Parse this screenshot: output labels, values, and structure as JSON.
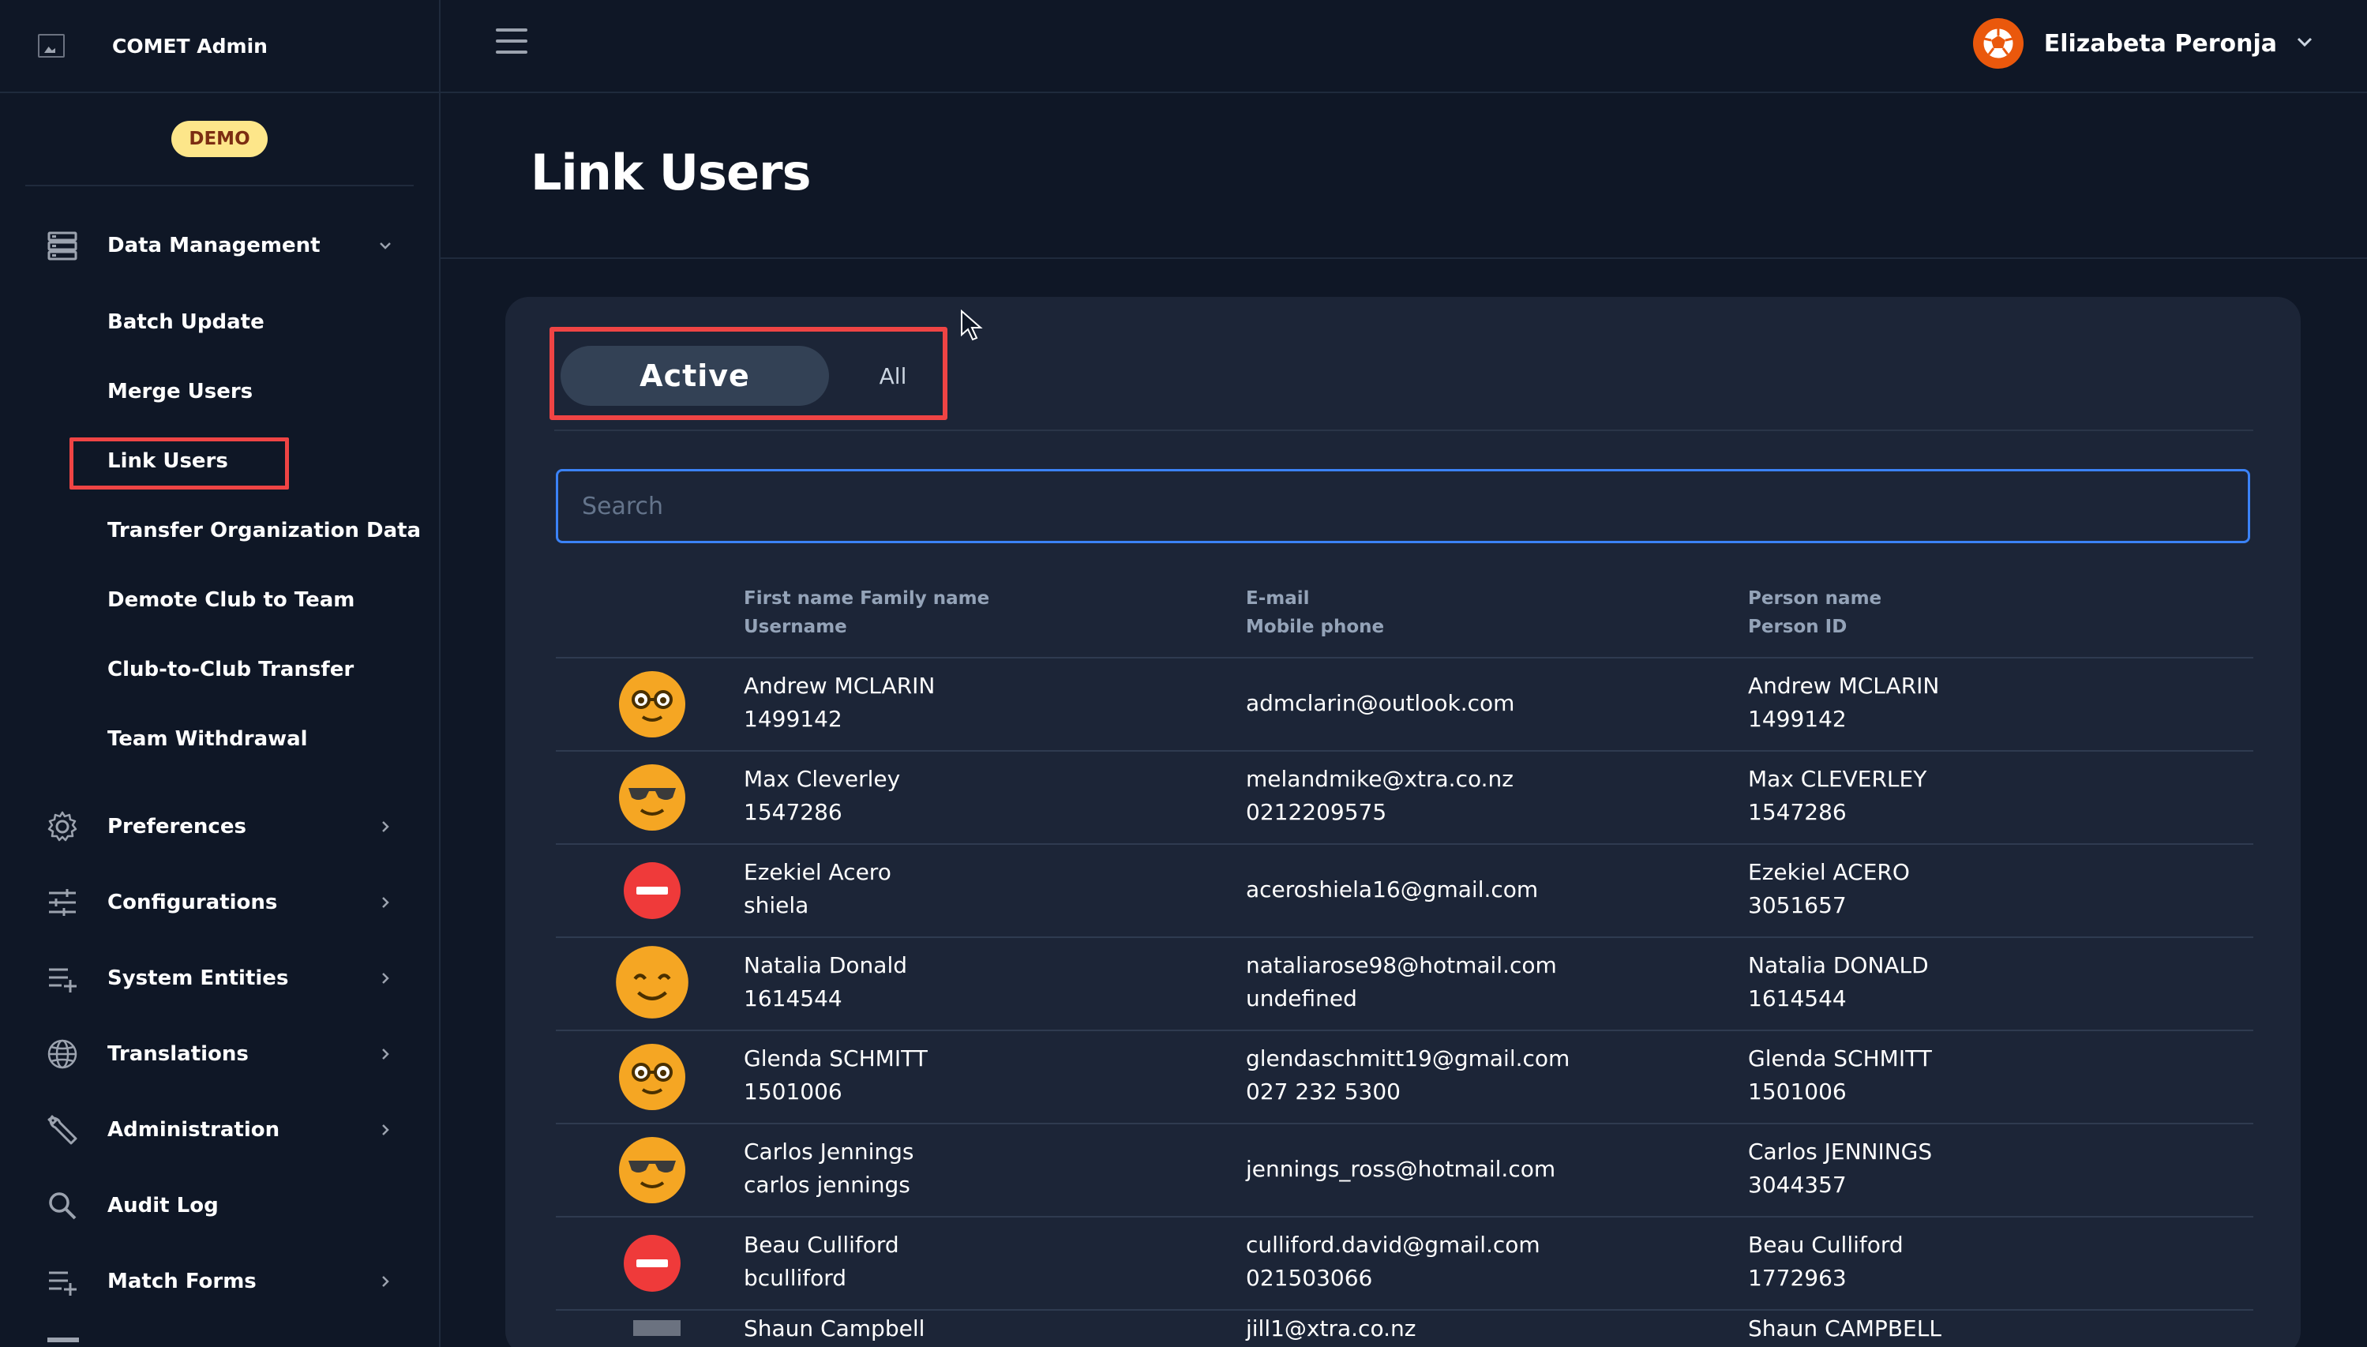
{
  "app": {
    "name": "COMET Admin",
    "badge": "DEMO"
  },
  "header": {
    "user_name": "Elizabeta Peronja"
  },
  "sidebar": {
    "data_management": {
      "label": "Data Management",
      "items": [
        {
          "label": "Batch Update"
        },
        {
          "label": "Merge Users"
        },
        {
          "label": "Link Users"
        },
        {
          "label": "Transfer Organization Data"
        },
        {
          "label": "Demote Club to Team"
        },
        {
          "label": "Club-to-Club Transfer"
        },
        {
          "label": "Team Withdrawal"
        }
      ]
    },
    "sections": [
      {
        "label": "Preferences",
        "icon": "gear-icon"
      },
      {
        "label": "Configurations",
        "icon": "sliders-icon"
      },
      {
        "label": "System Entities",
        "icon": "list-add-icon"
      },
      {
        "label": "Translations",
        "icon": "globe-icon"
      },
      {
        "label": "Administration",
        "icon": "wrench-icon"
      },
      {
        "label": "Audit Log",
        "icon": "search-icon"
      },
      {
        "label": "Match Forms",
        "icon": "list-add-icon"
      }
    ]
  },
  "page": {
    "title": "Link Users"
  },
  "tabs": {
    "active": "Active",
    "all": "All"
  },
  "search": {
    "placeholder": "Search"
  },
  "table": {
    "headers": {
      "col1_line1": "First name Family name",
      "col1_line2": "Username",
      "col2_line1": "E-mail",
      "col2_line2": "Mobile phone",
      "col3_line1": "Person name",
      "col3_line2": "Person ID"
    },
    "rows": [
      {
        "avatar": "nerd-face-icon",
        "name": "Andrew MCLARIN",
        "username": "1499142",
        "email": "admclarin@outlook.com",
        "phone": "",
        "person_name": "Andrew MCLARIN",
        "person_id": "1499142"
      },
      {
        "avatar": "sunglasses-face-icon",
        "name": "Max Cleverley",
        "username": "1547286",
        "email": "melandmike@xtra.co.nz",
        "phone": "0212209575",
        "person_name": "Max CLEVERLEY",
        "person_id": "1547286"
      },
      {
        "avatar": "no-entry-icon",
        "name": "Ezekiel Acero",
        "username": "shiela",
        "email": "aceroshiela16@gmail.com",
        "phone": "",
        "person_name": "Ezekiel ACERO",
        "person_id": "3051657"
      },
      {
        "avatar": "smiling-face-icon",
        "name": "Natalia Donald",
        "username": "1614544",
        "email": "nataliarose98@hotmail.com",
        "phone": "undefined",
        "person_name": "Natalia DONALD",
        "person_id": "1614544"
      },
      {
        "avatar": "nerd-face-icon",
        "name": "Glenda SCHMITT",
        "username": "1501006",
        "email": "glendaschmitt19@gmail.com",
        "phone": "027 232 5300",
        "person_name": "Glenda SCHMITT",
        "person_id": "1501006"
      },
      {
        "avatar": "sunglasses-face-icon",
        "name": "Carlos Jennings",
        "username": "carlos jennings",
        "email": "jennings_ross@hotmail.com",
        "phone": "",
        "person_name": "Carlos JENNINGS",
        "person_id": "3044357"
      },
      {
        "avatar": "no-entry-icon",
        "name": "Beau Culliford",
        "username": "bculliford",
        "email": "culliford.david@gmail.com",
        "phone": "021503066",
        "person_name": "Beau Culliford",
        "person_id": "1772963"
      },
      {
        "avatar": "placeholder-icon",
        "name": "Shaun Campbell",
        "username": "",
        "email": "jill1@xtra.co.nz",
        "phone": "",
        "person_name": "Shaun CAMPBELL",
        "person_id": ""
      }
    ]
  },
  "colors": {
    "accent": "#3b82f6",
    "highlight": "#ef4444",
    "badge": "#fde68a",
    "emoji": "#f5a623"
  }
}
